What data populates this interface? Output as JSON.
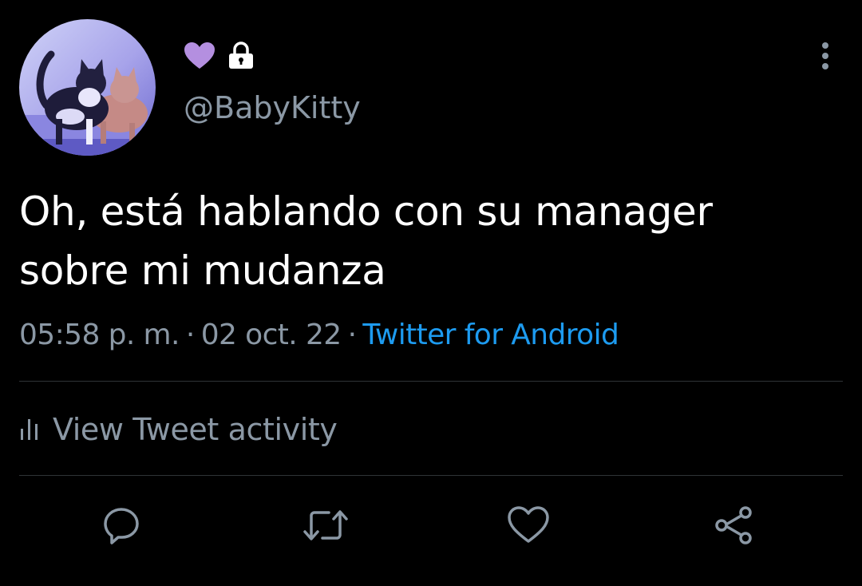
{
  "header": {
    "handle": "@BabyKitty",
    "heart_color": "#b48fe0",
    "icons": [
      "purple-heart-icon",
      "lock-icon",
      "more-vertical-icon"
    ]
  },
  "tweet": {
    "text": "Oh, está hablando con su manager sobre mi mudanza",
    "time": "05:58 p. m.",
    "separator": "·",
    "date": "02 oct. 22",
    "source": "Twitter for Android"
  },
  "activity": {
    "label": "View Tweet activity",
    "icon": "bar-chart-icon"
  },
  "actions": {
    "icons": [
      "reply-icon",
      "retweet-icon",
      "like-icon",
      "share-icon"
    ]
  },
  "colors": {
    "background": "#000000",
    "text": "#ffffff",
    "secondary": "#8b98a5",
    "link": "#1d9bf0",
    "divider": "#2f3336"
  }
}
